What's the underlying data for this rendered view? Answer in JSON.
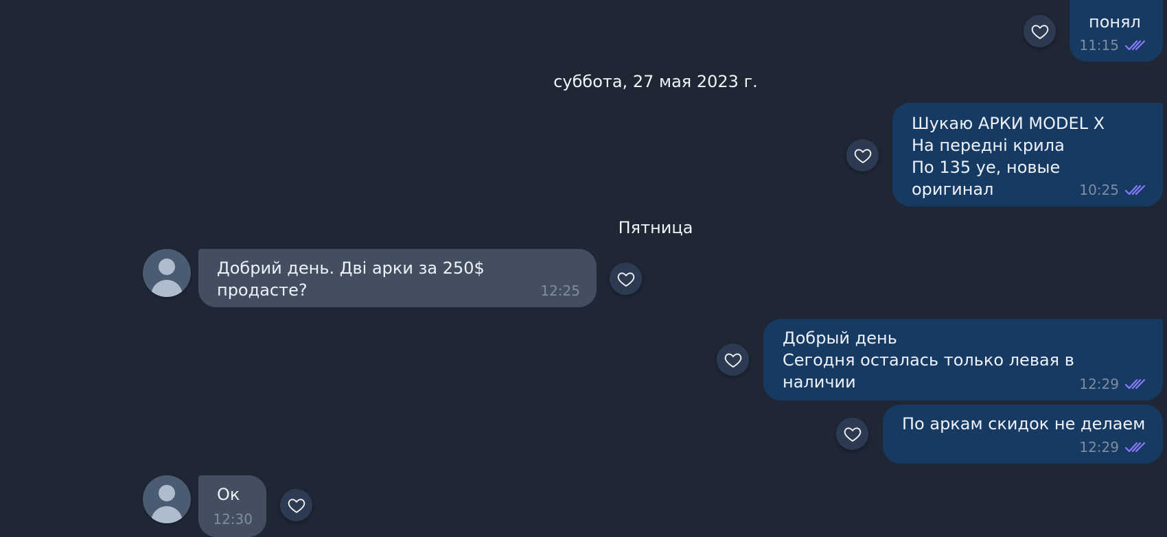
{
  "dates": {
    "first": "суббота, 27 мая 2023 г.",
    "second": "Пятница"
  },
  "messages": [
    {
      "direction": "out",
      "text": "понял",
      "time": "11:15",
      "status_icon": "double-check-icon",
      "reaction_icon": "heart-icon"
    },
    {
      "direction": "out",
      "text": "Шукаю АРКИ MODEL X\nНа передні крила\nПо 135 уе, новые оригинал",
      "time": "10:25",
      "status_icon": "double-check-icon",
      "reaction_icon": "heart-icon"
    },
    {
      "direction": "in",
      "text": "Добрий день. Дві арки за 250$ продасте?",
      "time": "12:25",
      "reaction_icon": "heart-icon",
      "avatar_icon": "user-avatar-icon"
    },
    {
      "direction": "out",
      "text": "Добрый день\nСегодня осталась только левая в наличии",
      "time": "12:29",
      "status_icon": "double-check-icon",
      "reaction_icon": "heart-icon"
    },
    {
      "direction": "out",
      "text": "По аркам скидок не делаем",
      "time": "12:29",
      "status_icon": "double-check-icon",
      "reaction_icon": "heart-icon"
    },
    {
      "direction": "in",
      "text": "Ок",
      "time": "12:30",
      "reaction_icon": "heart-icon",
      "avatar_icon": "user-avatar-icon"
    }
  ],
  "colors": {
    "background": "#1f2735",
    "outgoing_bubble": "#173a62",
    "incoming_bubble": "#434f61",
    "read_check": "#8b7cff",
    "timestamp": "#7e8da1"
  }
}
